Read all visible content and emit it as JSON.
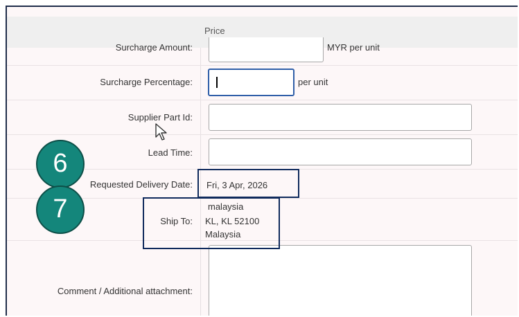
{
  "table": {
    "column_header": "Price"
  },
  "fields": {
    "surcharge_amount": {
      "label": "Surcharge Amount:",
      "value": "",
      "unit": "MYR per unit"
    },
    "surcharge_percentage": {
      "label": "Surcharge Percentage:",
      "value": "",
      "unit": "per unit"
    },
    "supplier_part_id": {
      "label": "Supplier Part Id:",
      "value": ""
    },
    "lead_time": {
      "label": "Lead Time:",
      "value": ""
    },
    "requested_delivery_date": {
      "label": "Requested Delivery Date:",
      "value": "Fri, 3 Apr, 2026"
    },
    "ship_to": {
      "label": "Ship To:",
      "line1": "malaysia",
      "line2": "KL, KL 52100",
      "line3": "Malaysia"
    },
    "comment": {
      "label": "Comment / Additional attachment:",
      "value": ""
    }
  },
  "annotations": {
    "step6": "6",
    "step7": "7"
  },
  "colors": {
    "badge": "#14867b",
    "highlight_border": "#0f2a5c",
    "focus_border": "#2f5ea8"
  }
}
